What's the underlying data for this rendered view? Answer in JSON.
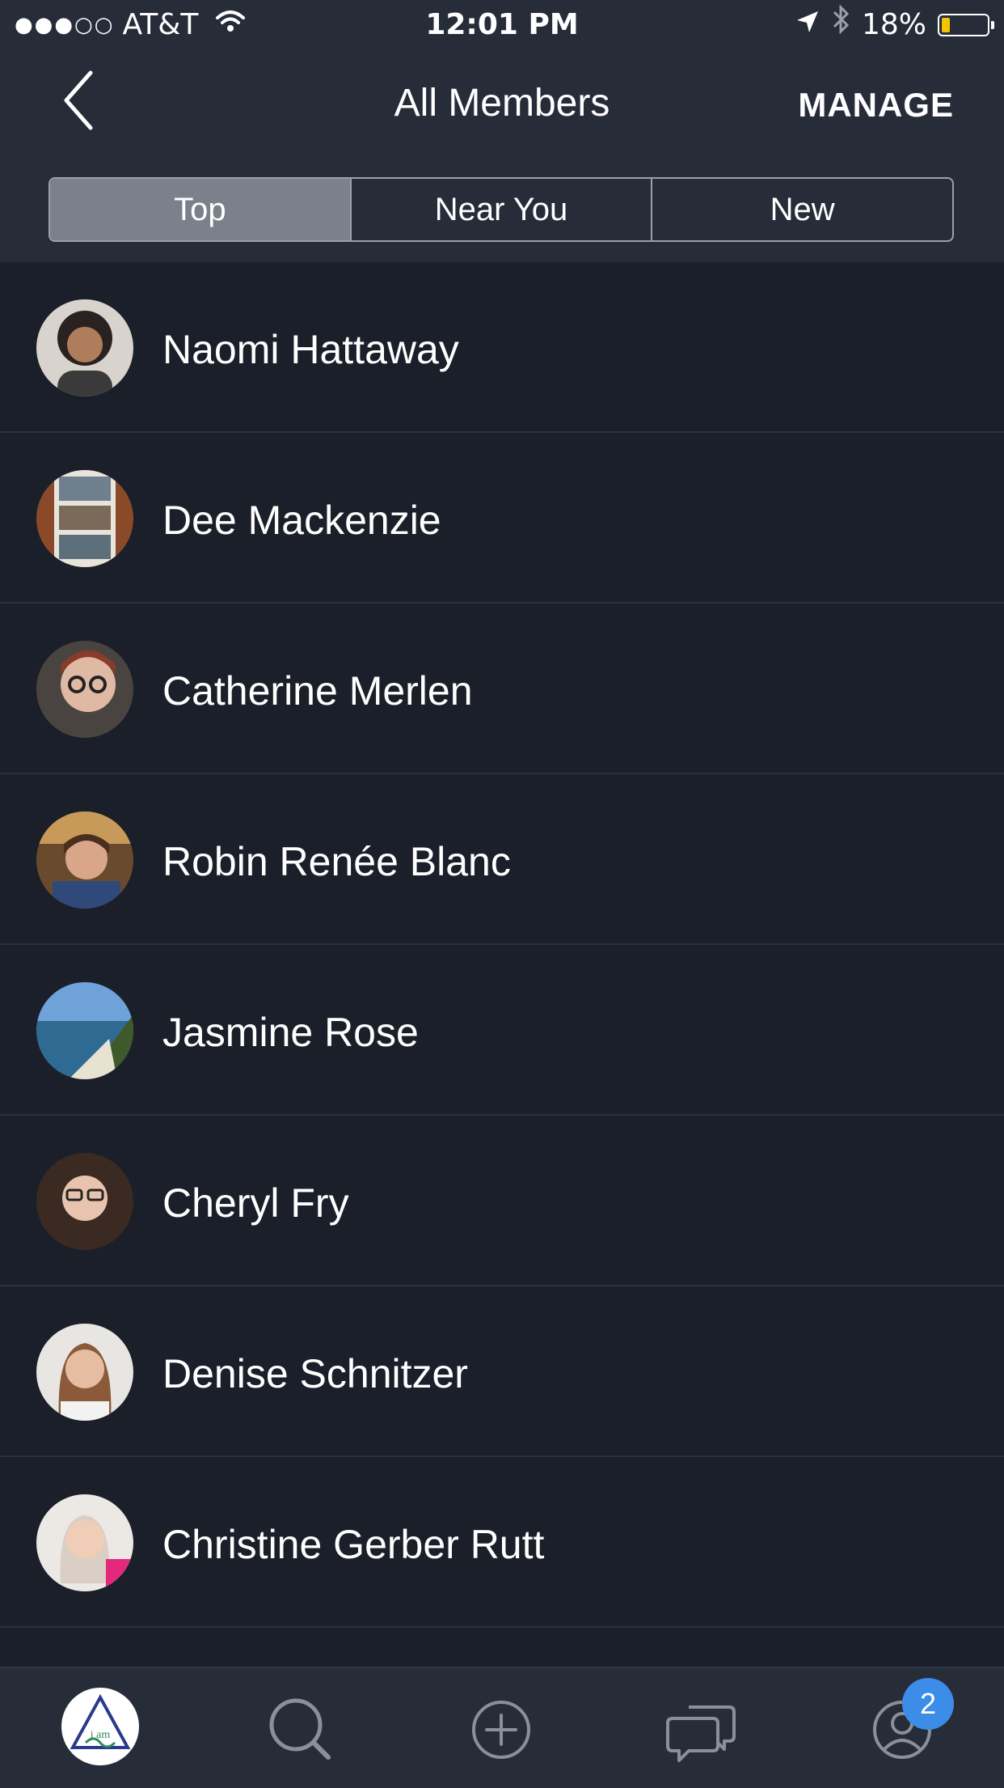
{
  "status_bar": {
    "signal": "●●●○○",
    "carrier": "AT&T",
    "time": "12:01 PM",
    "battery_percent": "18%",
    "battery_level": 0.18,
    "icons": [
      "wifi-icon",
      "location-arrow-icon",
      "bluetooth-icon",
      "battery-icon"
    ]
  },
  "nav": {
    "title": "All Members",
    "manage_label": "MANAGE",
    "back_icon": "chevron-left-icon"
  },
  "segments": {
    "items": [
      "Top",
      "Near You",
      "New"
    ],
    "selected": "Top"
  },
  "members": [
    {
      "name": "Naomi Hattaway"
    },
    {
      "name": "Dee Mackenzie"
    },
    {
      "name": "Catherine Merlen"
    },
    {
      "name": "Robin Renée Blanc"
    },
    {
      "name": "Jasmine Rose"
    },
    {
      "name": "Cheryl Fry"
    },
    {
      "name": "Denise Schnitzer"
    },
    {
      "name": "Christine Gerber Rutt"
    }
  ],
  "tab_bar": {
    "items": [
      {
        "icon": "community-logo-icon",
        "logo_text": "i am"
      },
      {
        "icon": "search-icon"
      },
      {
        "icon": "add-circle-icon"
      },
      {
        "icon": "chat-bubbles-icon"
      },
      {
        "icon": "profile-icon"
      }
    ],
    "notification_count": "2"
  },
  "colors": {
    "background": "#1b1f29",
    "header": "#272c39",
    "selected_segment": "#7b818b",
    "badge": "#3b8de8",
    "battery_fill": "#f5c400"
  }
}
